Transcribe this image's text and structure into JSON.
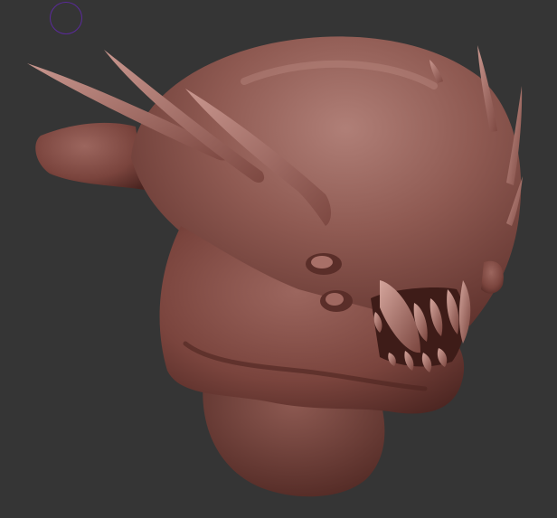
{
  "viewport": {
    "background_color": "#353535"
  },
  "brush_cursor": {
    "icon": "brush-circle-icon",
    "color": "#5a2a9a"
  },
  "model": {
    "icon": "sculpted-creature-head",
    "material_color": "#8a5048",
    "highlight_color": "#b07a72",
    "shadow_color": "#4a2420"
  }
}
